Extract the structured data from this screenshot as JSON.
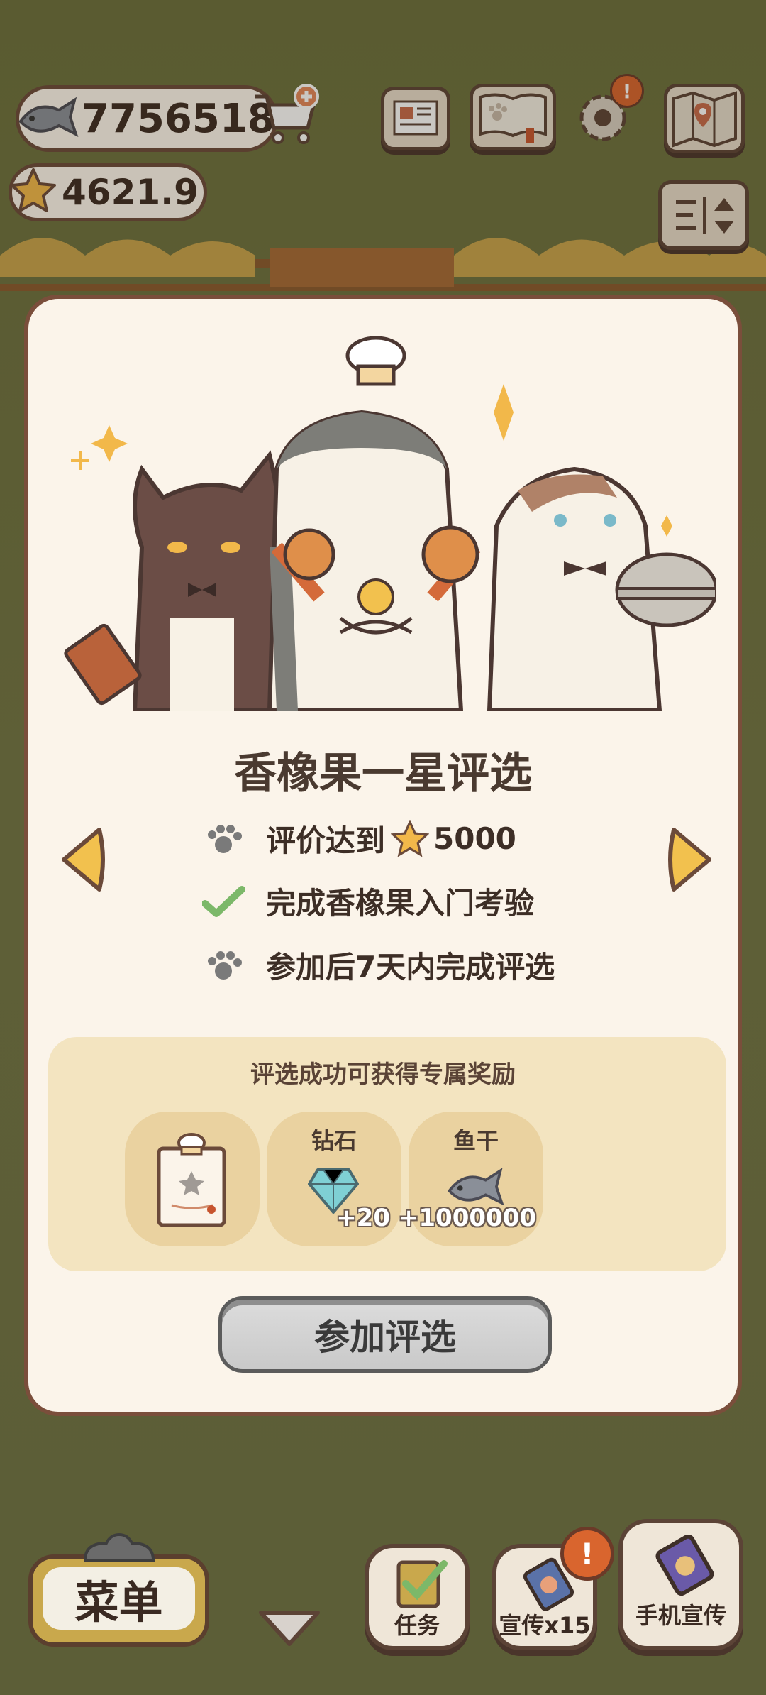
{
  "hud": {
    "fish_count": "7756518",
    "star_rating": "4621.9"
  },
  "modal": {
    "title": "香橡果一星评选",
    "requirements": [
      {
        "text_prefix": "评价达到",
        "value": "5000",
        "icon": "paw-icon",
        "done": false
      },
      {
        "text": "完成香橡果入门考验",
        "icon": "check-icon",
        "done": true
      },
      {
        "text": "参加后7天内完成评选",
        "icon": "paw-icon",
        "done": false
      }
    ],
    "reward_title": "评选成功可获得专属奖励",
    "rewards": [
      {
        "label": "",
        "amount": "",
        "icon": "certificate-icon"
      },
      {
        "label": "钻石",
        "amount": "+20",
        "icon": "diamond-icon"
      },
      {
        "label": "鱼干",
        "amount": "+1000000",
        "icon": "dried-fish-icon"
      }
    ],
    "join_button": "参加评选"
  },
  "bottom_bar": {
    "menu": "菜单",
    "tasks": "任务",
    "promo": "宣传x15",
    "phone_promo": "手机宣传"
  },
  "colors": {
    "accent_yellow": "#f2c14e",
    "border_brown": "#7a4e3b",
    "modal_bg": "#fbf4ea",
    "reward_bg": "#f3e4c0",
    "badge_orange": "#d9652e"
  }
}
